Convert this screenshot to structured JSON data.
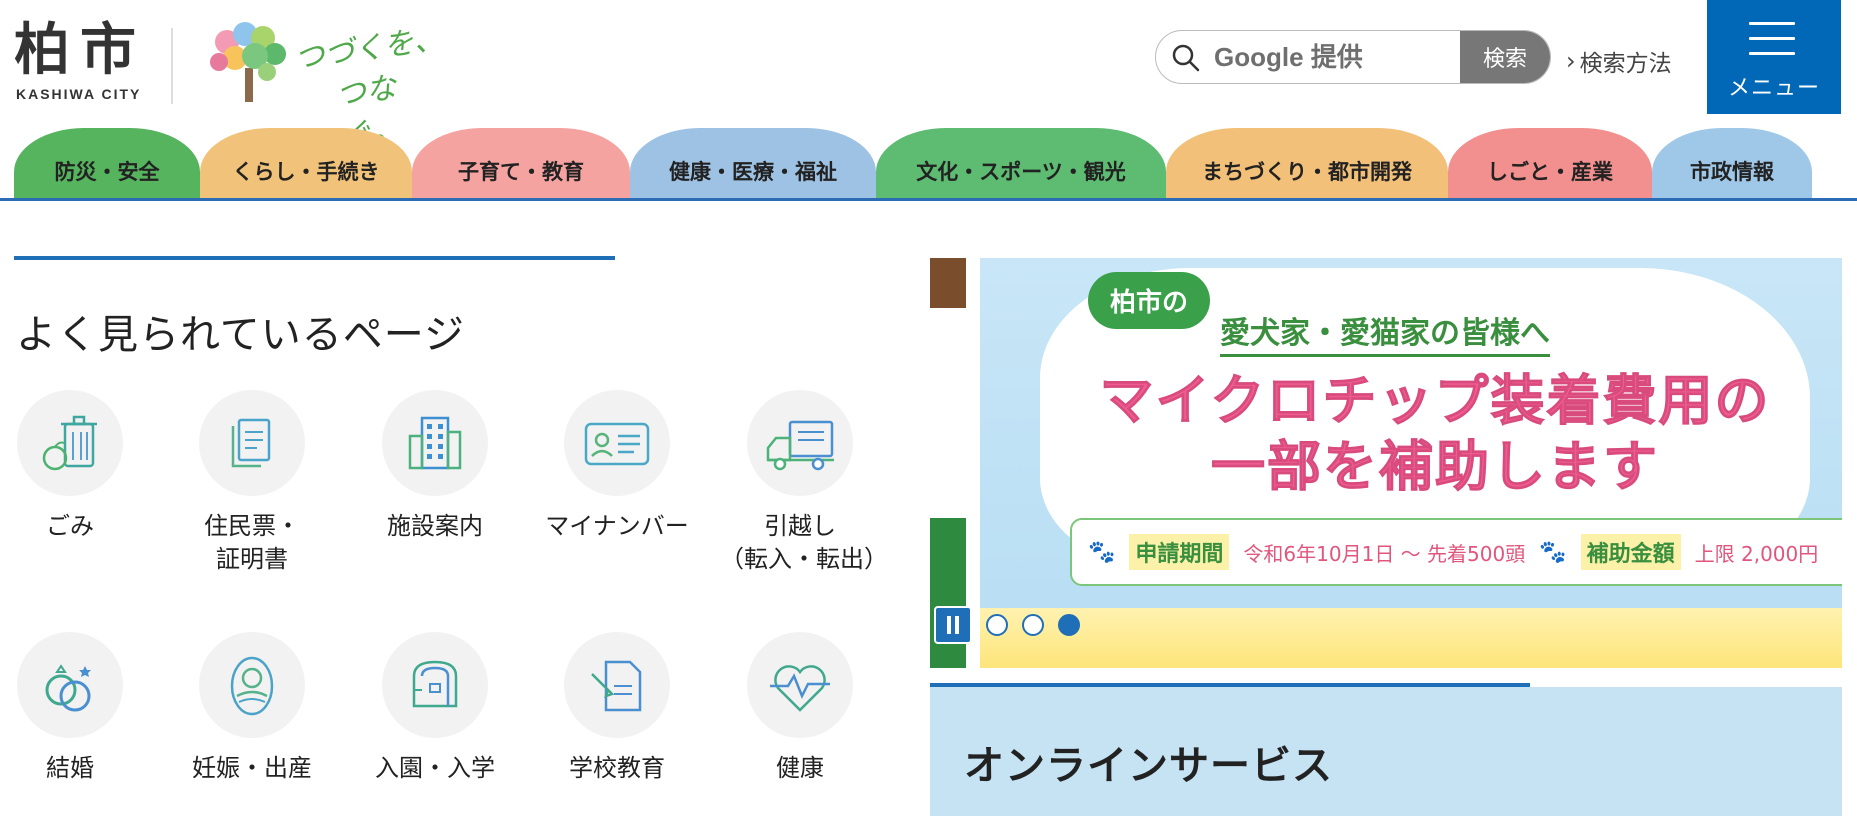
{
  "header": {
    "logo_kanji": "柏市",
    "logo_roman": "KASHIWA CITY",
    "tagline_line1": "つづくを、",
    "tagline_line2": "つなぐ。",
    "search": {
      "placeholder": "Google 提供",
      "button_label": "検索",
      "help_label": "検索方法"
    },
    "menu_label": "メニュー"
  },
  "category_tabs": [
    {
      "label": "防災・安全",
      "color": "#56b35e"
    },
    {
      "label": "くらし・手続き",
      "color": "#f1c27a"
    },
    {
      "label": "子育て・教育",
      "color": "#f4a3a0"
    },
    {
      "label": "健康・医療・福祉",
      "color": "#9dc2e3"
    },
    {
      "label": "文化・スポーツ・観光",
      "color": "#5dbb72"
    },
    {
      "label": "まちづくり・都市開発",
      "color": "#f3c079"
    },
    {
      "label": "しごと・産業",
      "color": "#f1908e"
    },
    {
      "label": "市政情報",
      "color": "#9fc8e8"
    }
  ],
  "popular": {
    "title": "よく見られているページ",
    "items": [
      {
        "label": "ごみ",
        "icon": "trash-icon"
      },
      {
        "label": "住民票・\n証明書",
        "icon": "document-icon"
      },
      {
        "label": "施設案内",
        "icon": "building-icon"
      },
      {
        "label": "マイナンバー",
        "icon": "id-card-icon"
      },
      {
        "label": "引越し\n（転入・転出）",
        "icon": "truck-icon"
      },
      {
        "label": "結婚",
        "icon": "rings-icon"
      },
      {
        "label": "妊娠・出産",
        "icon": "baby-icon"
      },
      {
        "label": "入園・入学",
        "icon": "school-bag-icon"
      },
      {
        "label": "学校教育",
        "icon": "pencil-paper-icon"
      },
      {
        "label": "健康",
        "icon": "heart-pulse-icon"
      }
    ]
  },
  "banner": {
    "city_pill": "柏市の",
    "subtitle": "愛犬家・愛猫家の皆様へ",
    "headline_line1": "マイクロチップ装着費用の",
    "headline_line2": "一部を補助します",
    "period_tag": "申請期間",
    "period_text": "令和6年10月1日 ～ 先着500頭",
    "amount_tag": "補助金額",
    "amount_text": "上限 2,000円",
    "slide_count": 3,
    "active_slide": 3
  },
  "online": {
    "title": "オンラインサービス"
  },
  "colors": {
    "brand_blue": "#0068b7",
    "accent_blue": "#1f6fb8",
    "banner_pink": "#ef5d8f",
    "banner_green": "#3aa14a"
  }
}
